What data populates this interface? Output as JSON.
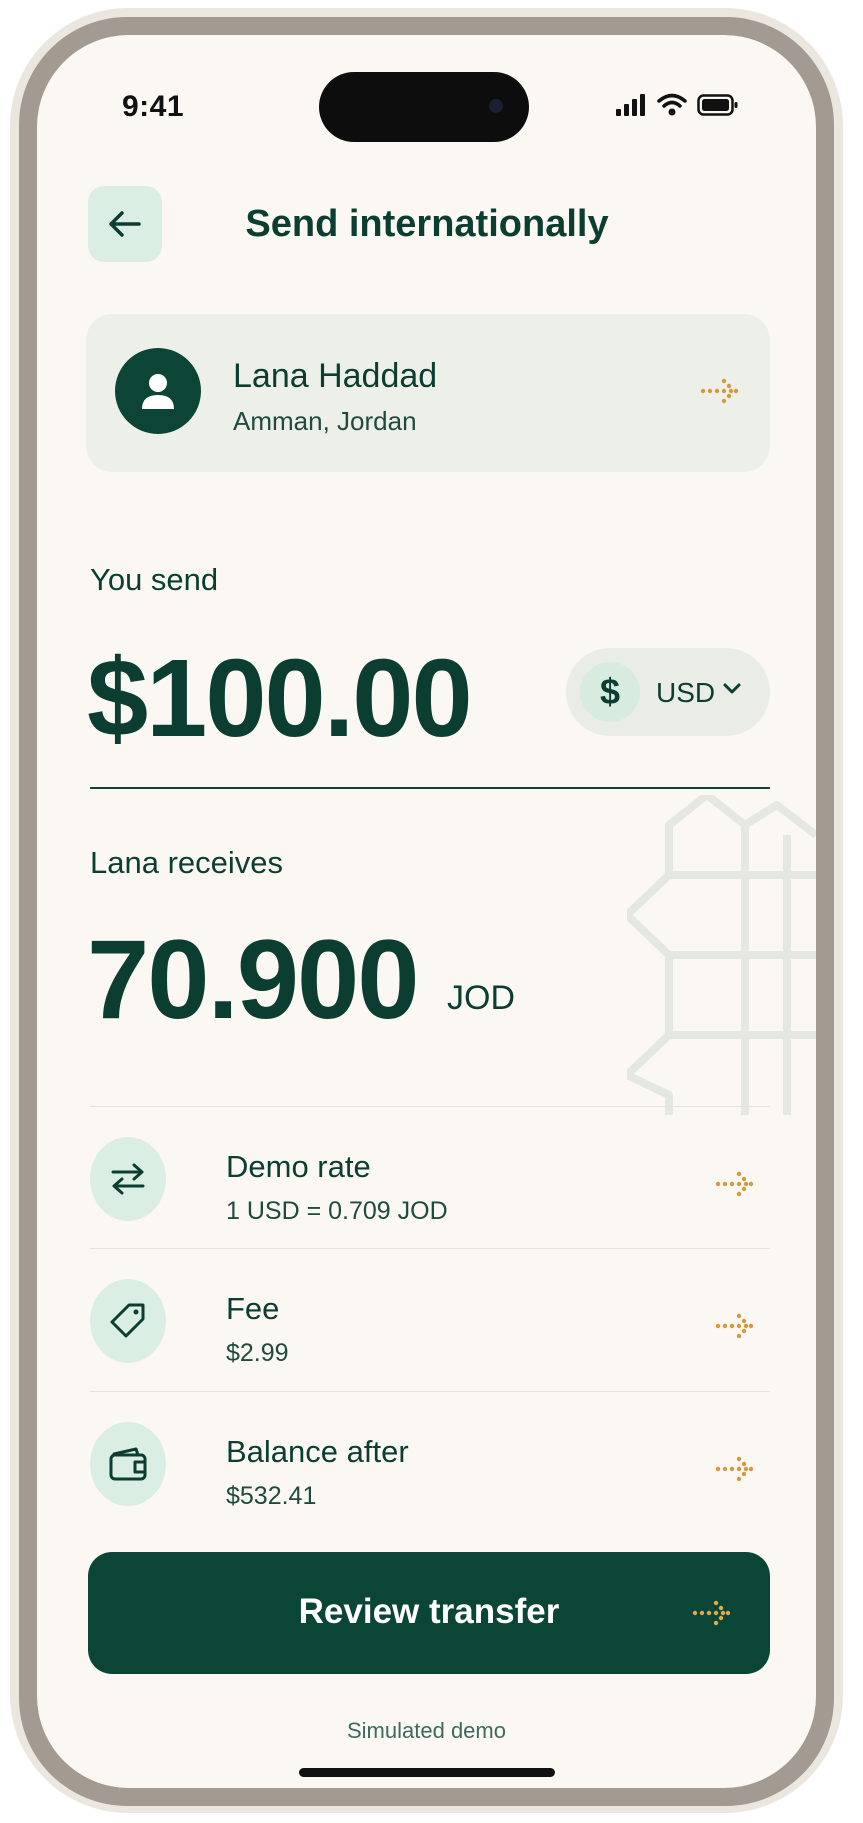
{
  "status_bar": {
    "time": "9:41",
    "signal_icon": "signal-icon",
    "wifi_icon": "wifi-icon",
    "battery_icon": "battery-icon"
  },
  "header": {
    "title": "Send internationally",
    "back_icon": "arrow-left-icon"
  },
  "recipient": {
    "name": "Lana Haddad",
    "location": "Amman, Jordan",
    "avatar_icon": "user-icon",
    "arrow_icon": "dotted-arrow-right-icon"
  },
  "send": {
    "label": "You send",
    "amount": "$100.00",
    "currency_symbol": "$",
    "currency_code": "USD",
    "chevron_icon": "chevron-down-icon"
  },
  "receive": {
    "label": "Lana receives",
    "amount": "70.900",
    "currency_code": "JOD"
  },
  "details": [
    {
      "title": "Demo rate",
      "value": "1 USD = 0.709 JOD",
      "icon": "swap-arrows-icon"
    },
    {
      "title": "Fee",
      "value": "$2.99",
      "icon": "tag-icon"
    },
    {
      "title": "Balance after",
      "value": "$532.41",
      "icon": "wallet-icon"
    }
  ],
  "cta": {
    "label": "Review transfer",
    "arrow_icon": "dotted-arrow-right-icon"
  },
  "footer": {
    "note": "Simulated demo"
  },
  "colors": {
    "primary": "#0a4536",
    "accent": "#d49a3a",
    "background": "#fbf8f3",
    "soft_green": "#dbeee4"
  }
}
